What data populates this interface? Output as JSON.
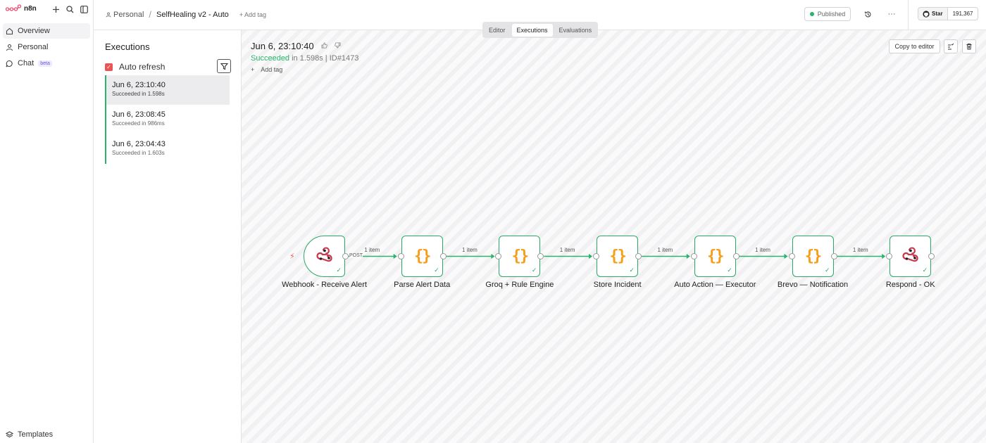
{
  "app": {
    "logo_text": "n8n"
  },
  "sidebar": {
    "items": [
      {
        "label": "Overview",
        "icon": "home-icon"
      },
      {
        "label": "Personal",
        "icon": "user-icon"
      },
      {
        "label": "Chat",
        "icon": "chat-icon",
        "badge": "beta"
      }
    ],
    "bottom": {
      "label": "Templates",
      "icon": "templates-icon"
    }
  },
  "header": {
    "breadcrumb_project": "Personal",
    "workflow_name": "SelfHealing v2 - Auto",
    "add_tag": "+ Add tag",
    "published": "Published",
    "github_star": "Star",
    "github_count": "191,367"
  },
  "tabs": [
    {
      "label": "Editor",
      "active": false
    },
    {
      "label": "Executions",
      "active": true
    },
    {
      "label": "Evaluations",
      "active": false
    }
  ],
  "executions": {
    "title": "Executions",
    "auto_refresh": "Auto refresh",
    "items": [
      {
        "date": "Jun 6, 23:10:40",
        "status": "Succeeded in 1.598s",
        "active": true
      },
      {
        "date": "Jun 6, 23:08:45",
        "status": "Succeeded in 986ms",
        "active": false
      },
      {
        "date": "Jun 6, 23:04:43",
        "status": "Succeeded in 1.603s",
        "active": false
      }
    ]
  },
  "run": {
    "date": "Jun 6, 23:10:40",
    "status_word": "Succeeded",
    "status_rest": " in 1.598s | ID#1473",
    "add_tag": "Add tag",
    "copy_to_editor": "Copy to editor"
  },
  "workflow": {
    "nodes": [
      {
        "name": "Webhook - Receive Alert",
        "icon": "webhook-icon",
        "trigger": true
      },
      {
        "name": "Parse Alert Data",
        "icon": "code-icon"
      },
      {
        "name": "Groq + Rule Engine",
        "icon": "code-icon"
      },
      {
        "name": "Store Incident",
        "icon": "code-icon"
      },
      {
        "name": "Auto Action — Executor",
        "icon": "code-icon"
      },
      {
        "name": "Brevo — Notification",
        "icon": "code-icon"
      },
      {
        "name": "Respond - OK",
        "icon": "webhook-icon"
      }
    ],
    "connections": [
      {
        "label": "1 item",
        "method": "POST"
      },
      {
        "label": "1 item"
      },
      {
        "label": "1 item"
      },
      {
        "label": "1 item"
      },
      {
        "label": "1 item"
      },
      {
        "label": "1 item"
      }
    ],
    "code_glyph": "{}",
    "check_glyph": "✓"
  },
  "colors": {
    "success": "#29b36b",
    "accent": "#ea5455",
    "code": "#f59e1b",
    "webhook": "#c9364d"
  }
}
